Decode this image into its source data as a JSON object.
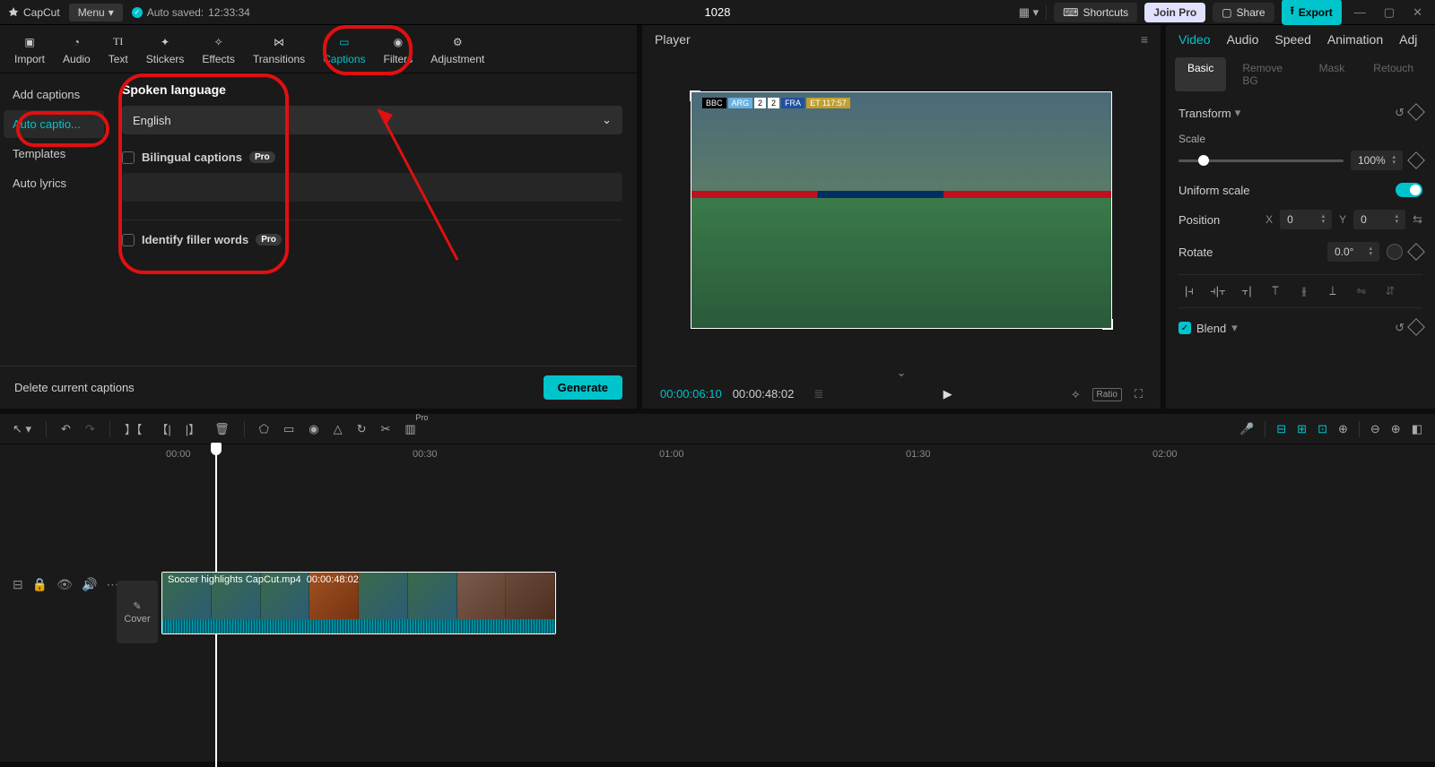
{
  "topbar": {
    "app_name": "CapCut",
    "menu_label": "Menu",
    "autosave_label": "Auto saved:",
    "autosave_time": "12:33:34",
    "project_title": "1028",
    "shortcuts": "Shortcuts",
    "joinpro": "Join Pro",
    "share": "Share",
    "export": "Export"
  },
  "left_tabs": {
    "import": "Import",
    "audio": "Audio",
    "text": "Text",
    "stickers": "Stickers",
    "effects": "Effects",
    "transitions": "Transitions",
    "captions": "Captions",
    "filters": "Filters",
    "adjustment": "Adjustment"
  },
  "sidebar": {
    "add_captions": "Add captions",
    "auto_captions": "Auto captio...",
    "templates": "Templates",
    "auto_lyrics": "Auto lyrics"
  },
  "captions_form": {
    "heading": "Spoken language",
    "language": "English",
    "bilingual_label": "Bilingual captions",
    "filler_label": "Identify filler words",
    "pro_badge": "Pro",
    "delete_label": "Delete current captions",
    "generate_label": "Generate"
  },
  "player": {
    "title": "Player",
    "current_time": "00:00:06:10",
    "total_time": "00:00:48:02",
    "score_bbc": "BBC",
    "score_arg": "ARG",
    "score_arg_n": "2",
    "score_fra_n": "2",
    "score_fra": "FRA",
    "score_et": "ET 117:57",
    "ratio_label": "Ratio"
  },
  "inspector": {
    "tabs": {
      "video": "Video",
      "audio": "Audio",
      "speed": "Speed",
      "animation": "Animation",
      "adj": "Adj"
    },
    "subtabs": {
      "basic": "Basic",
      "removebg": "Remove BG",
      "mask": "Mask",
      "retouch": "Retouch"
    },
    "transform": "Transform",
    "scale_label": "Scale",
    "scale_value": "100%",
    "uniform_label": "Uniform scale",
    "position_label": "Position",
    "pos_x": "0",
    "pos_y": "0",
    "rotate_label": "Rotate",
    "rotate_value": "0.0°",
    "blend_label": "Blend"
  },
  "timeline": {
    "ticks": [
      "00:00",
      "00:30",
      "01:00",
      "01:30",
      "02:00"
    ],
    "clip_name": "Soccer highlights CapCut.mp4",
    "clip_duration": "00:00:48:02",
    "cover_label": "Cover",
    "pro_badge": "Pro"
  }
}
